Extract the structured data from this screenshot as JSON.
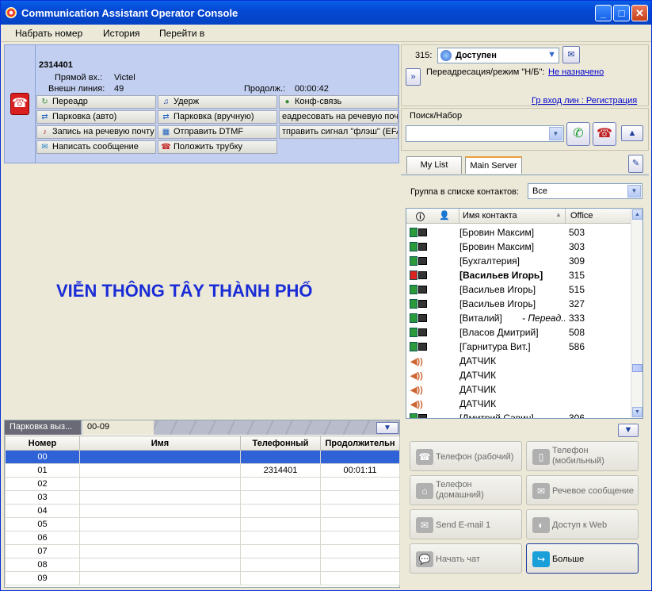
{
  "window": {
    "title": "Communication Assistant Operator Console"
  },
  "menu": [
    "Набрать номер",
    "История",
    "Перейти в"
  ],
  "call": {
    "number": "2314401",
    "direct_in_label": "Прямой вх.:",
    "direct_in_value": "Victel",
    "ext_line_label": "Внешн линия:",
    "ext_line_value": "49",
    "duration_label": "Продолж.:",
    "duration_value": "00:00:42"
  },
  "call_buttons": [
    {
      "label": "Переадр",
      "icon": "transfer-icon"
    },
    {
      "label": "Удерж",
      "icon": "hold-icon"
    },
    {
      "label": "Конф-связь",
      "icon": "conference-icon"
    },
    {
      "label": "Парковка (авто)",
      "icon": "park-auto-icon"
    },
    {
      "label": "Парковка (вручную)",
      "icon": "park-manual-icon"
    },
    {
      "label": "еадресовать на речевую поч",
      "icon": ""
    },
    {
      "label": "Запись на речевую почту",
      "icon": "record-voicemail-icon"
    },
    {
      "label": "Отправить DTMF",
      "icon": "dtmf-icon"
    },
    {
      "label": "тправить сигнал \"флэш\" (EFA",
      "icon": ""
    },
    {
      "label": "Написать сообщение",
      "icon": "message-icon"
    },
    {
      "label": "Положить трубку",
      "icon": "hangup-icon"
    }
  ],
  "banner": "VIỄN THÔNG TÂY THÀNH PHỐ",
  "park": {
    "tabs": [
      "Парковка выз...",
      "00-09"
    ],
    "columns": [
      "Номер",
      "Имя",
      "Телефонный",
      "Продолжительн"
    ],
    "rows": [
      {
        "num": "00",
        "name": "",
        "phone": "",
        "dur": ""
      },
      {
        "num": "01",
        "name": "",
        "phone": "2314401",
        "dur": "00:01:11"
      },
      {
        "num": "02",
        "name": "",
        "phone": "",
        "dur": ""
      },
      {
        "num": "03",
        "name": "",
        "phone": "",
        "dur": ""
      },
      {
        "num": "04",
        "name": "",
        "phone": "",
        "dur": ""
      },
      {
        "num": "05",
        "name": "",
        "phone": "",
        "dur": ""
      },
      {
        "num": "06",
        "name": "",
        "phone": "",
        "dur": ""
      },
      {
        "num": "07",
        "name": "",
        "phone": "",
        "dur": ""
      },
      {
        "num": "08",
        "name": "",
        "phone": "",
        "dur": ""
      },
      {
        "num": "09",
        "name": "",
        "phone": "",
        "dur": ""
      }
    ]
  },
  "status": {
    "ext": "315:",
    "value": "Доступен",
    "forward_label": "Переадресация/режим \"Н/Б\":",
    "forward_value": "Не назначено",
    "group_link": "Гр вход лин : Регистрация"
  },
  "search": {
    "label": "Поиск/Набор",
    "value": ""
  },
  "contact_tabs": [
    "My List",
    "Main Server"
  ],
  "group": {
    "label": "Группа в списке контактов:",
    "value": "Все"
  },
  "contacts": {
    "columns": [
      "Имя контакта",
      "Office"
    ],
    "rows": [
      {
        "type": "user",
        "status": "green",
        "name": "[Бровин Максим]",
        "office": "503",
        "extra": ""
      },
      {
        "type": "user",
        "status": "green",
        "name": "[Бровин Максим]",
        "office": "303",
        "extra": ""
      },
      {
        "type": "user",
        "status": "green",
        "name": "[Бухгалтерия]",
        "office": "309",
        "extra": ""
      },
      {
        "type": "user",
        "status": "red",
        "name": "[Васильев Игорь]",
        "office": "315",
        "extra": "...",
        "bold": true
      },
      {
        "type": "user",
        "status": "green",
        "name": "[Васильев Игорь]",
        "office": "515",
        "extra": ""
      },
      {
        "type": "user",
        "status": "green",
        "name": "[Васильев Игорь]",
        "office": "327",
        "extra": ""
      },
      {
        "type": "user",
        "status": "green",
        "name": "[Виталий]",
        "office": "333",
        "extra": "- Переад..."
      },
      {
        "type": "user",
        "status": "green",
        "name": "[Власов Дмитрий]",
        "office": "508",
        "extra": ""
      },
      {
        "type": "user",
        "status": "green",
        "name": "[Гарнитура Вит.]",
        "office": "586",
        "extra": ""
      },
      {
        "type": "sensor",
        "status": "",
        "name": "ДАТЧИК",
        "office": "",
        "extra": ""
      },
      {
        "type": "sensor",
        "status": "",
        "name": "ДАТЧИК",
        "office": "",
        "extra": ""
      },
      {
        "type": "sensor",
        "status": "",
        "name": "ДАТЧИК",
        "office": "",
        "extra": ""
      },
      {
        "type": "sensor",
        "status": "",
        "name": "ДАТЧИК",
        "office": "",
        "extra": ""
      },
      {
        "type": "user",
        "status": "green",
        "name": "[Дмитрий Савин]",
        "office": "306",
        "extra": ""
      }
    ]
  },
  "actions": [
    {
      "label": "Телефон (рабочий)",
      "icon": "work-phone-icon"
    },
    {
      "label": "Телефон (мобильный)",
      "icon": "mobile-phone-icon"
    },
    {
      "label": "Телефон (домашний)",
      "icon": "home-phone-icon"
    },
    {
      "label": "Речевое сообщение",
      "icon": "voice-message-icon"
    },
    {
      "label": "Send E-mail 1",
      "icon": "email-icon"
    },
    {
      "label": "Доступ к Web",
      "icon": "web-icon"
    },
    {
      "label": "Начать чат",
      "icon": "chat-icon"
    },
    {
      "label": "Больше",
      "icon": "more-icon"
    }
  ]
}
